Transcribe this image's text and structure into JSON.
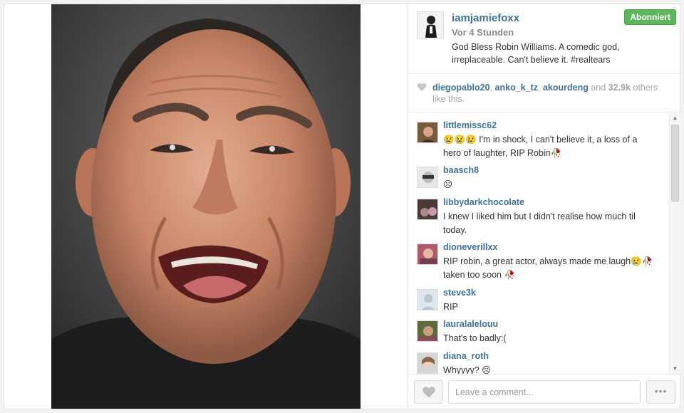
{
  "post": {
    "username": "iamjamiefoxx",
    "time_ago": "Vor 4 Stunden",
    "caption": "God Bless Robin Williams. A comedic god, irreplaceable. Can't believe it. #realtears",
    "follow_label": "Abonniert"
  },
  "likes": {
    "users": [
      "diegopablo20",
      "anko_k_tz",
      "akourdeng"
    ],
    "sep": ", ",
    "and_text": " and ",
    "count": "32.9k",
    "suffix": " others like this."
  },
  "comments": [
    {
      "user": "littlemissc62",
      "text": "😢😢😢 I'm in shock, I can't believe it, a loss of a hero of laughter, RIP Robin🥀"
    },
    {
      "user": "baasch8",
      "text": "☹"
    },
    {
      "user": "libbydarkchocolate",
      "text": "I knew I liked him but I didn't realise how much til today."
    },
    {
      "user": "dioneverillxx",
      "text": "RIP robin, a great actor, always made me laugh😢🥀taken too soon 🥀"
    },
    {
      "user": "steve3k",
      "text": "RIP"
    },
    {
      "user": "lauralalelouu",
      "text": "That's to badly:("
    },
    {
      "user": "diana_roth",
      "text": "Whyyyy? ☹"
    }
  ],
  "footer": {
    "comment_placeholder": "Leave a comment...",
    "more_label": "•••"
  },
  "colors": {
    "link": "#3f729b",
    "follow_green": "#5bb65c"
  }
}
